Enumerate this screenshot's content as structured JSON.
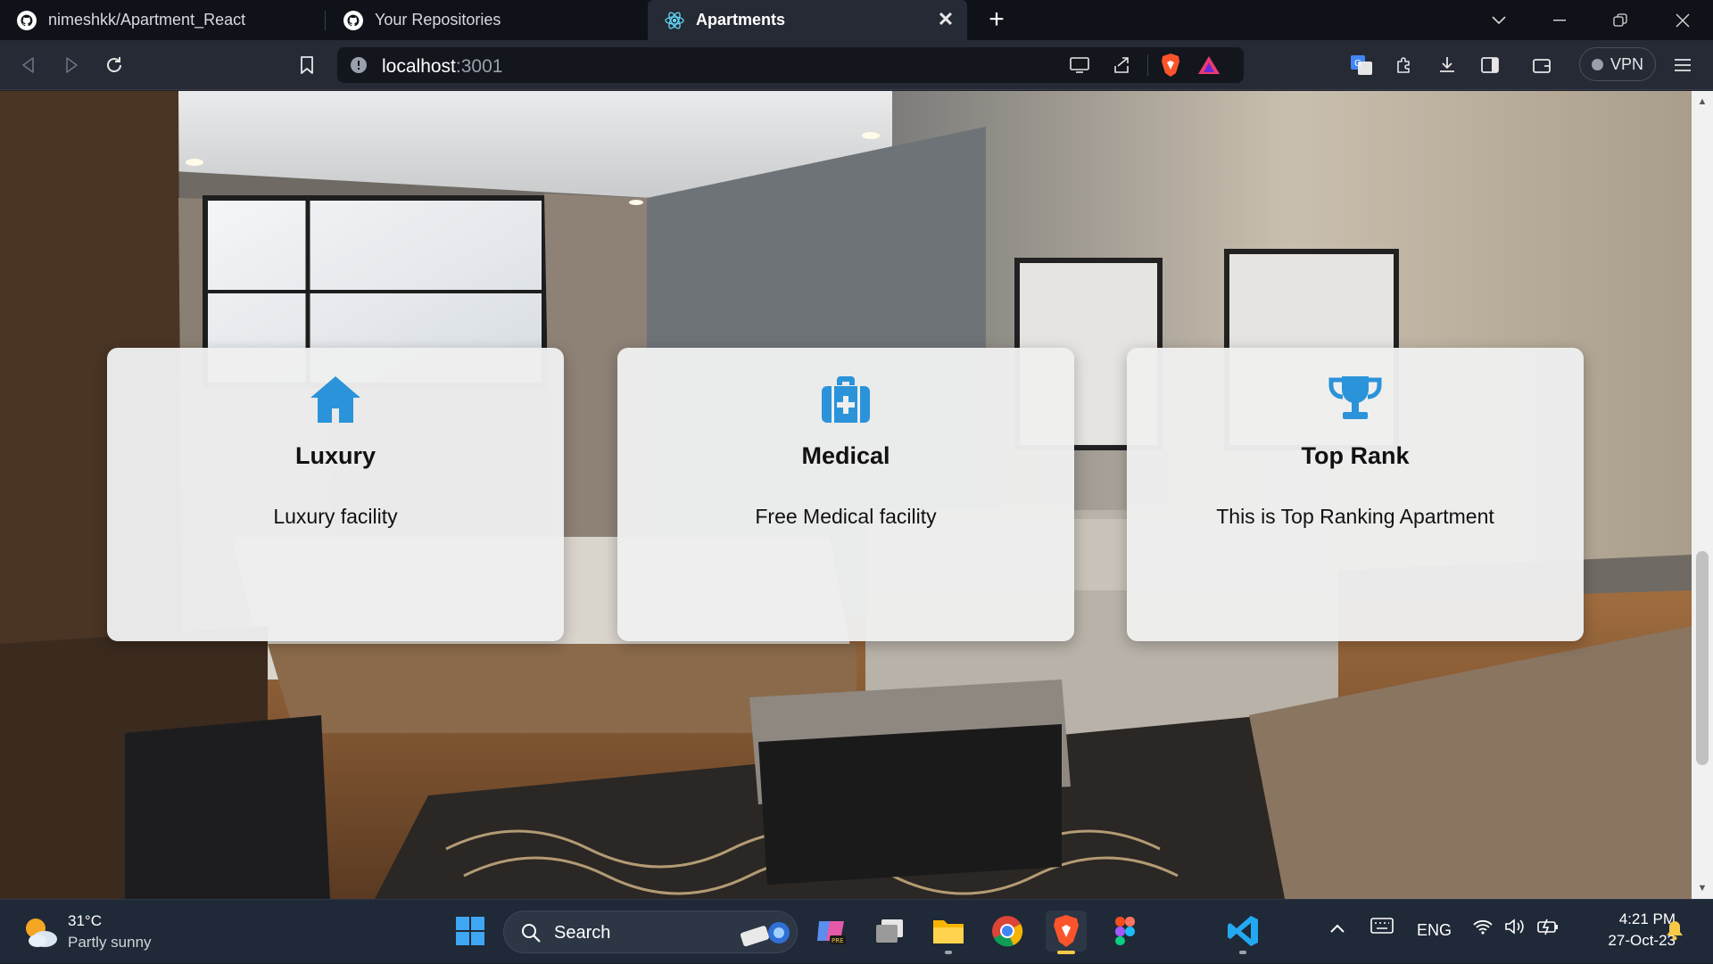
{
  "browser": {
    "tabs": [
      {
        "title": "nimeshkk/Apartment_React",
        "icon": "github-icon",
        "active": false
      },
      {
        "title": "Your Repositories",
        "icon": "github-icon",
        "active": false
      },
      {
        "title": "Apartments",
        "icon": "react-icon",
        "active": true
      }
    ],
    "close_symbol": "✕",
    "new_tab_symbol": "+",
    "url_host": "localhost",
    "url_port": ":3001",
    "vpn_label": "VPN"
  },
  "page": {
    "cards": [
      {
        "icon": "home-icon",
        "title": "Luxury",
        "text": "Luxury facility"
      },
      {
        "icon": "medical-bag-icon",
        "title": "Medical",
        "text": "Free Medical facility"
      },
      {
        "icon": "trophy-icon",
        "title": "Top Rank",
        "text": "This is Top Ranking Apartment"
      }
    ],
    "accent_color": "#2b93d9"
  },
  "taskbar": {
    "weather_temp": "31°C",
    "weather_desc": "Partly sunny",
    "search_label": "Search",
    "language": "ENG",
    "time": "4:21 PM",
    "date": "27-Oct-23"
  }
}
